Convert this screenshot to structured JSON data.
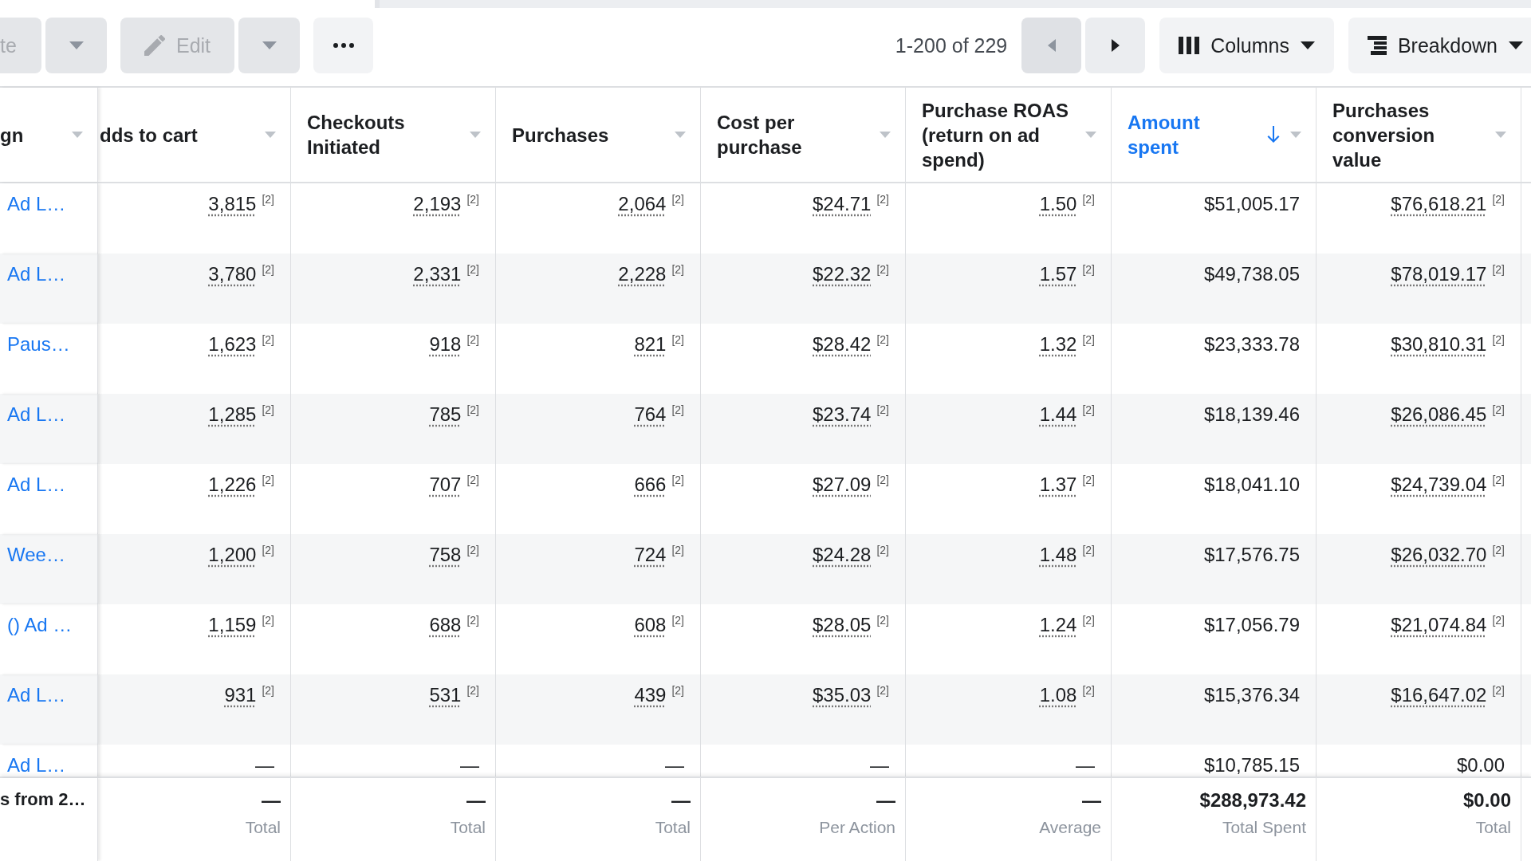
{
  "toolbar": {
    "actions": [
      {
        "kind": "split",
        "label": "te",
        "disabled": true
      },
      {
        "kind": "edit",
        "label": "Edit",
        "disabled": true
      },
      {
        "kind": "more"
      }
    ],
    "pagination": {
      "range": "1-200 of 229",
      "buttons": [
        {
          "kind": "prev",
          "disabled": true
        },
        {
          "kind": "next",
          "disabled": false
        }
      ]
    },
    "view_buttons": [
      {
        "kind": "columns",
        "label": "Columns"
      },
      {
        "kind": "breakdown",
        "label": "Breakdown"
      }
    ]
  },
  "table": {
    "columns": [
      {
        "label": "gn",
        "sorted": false
      },
      {
        "label": "dds to cart",
        "sorted": false
      },
      {
        "label": "Checkouts Initiated",
        "sorted": false
      },
      {
        "label": "Purchases",
        "sorted": false
      },
      {
        "label": "Cost per purchase",
        "sorted": false
      },
      {
        "label": "Purchase ROAS (return on ad spend)",
        "sorted": false
      },
      {
        "label": "Amount spent",
        "sorted": true
      },
      {
        "label": "Purchases conversion value",
        "sorted": false
      }
    ],
    "rows": [
      {
        "name": "Ad L…",
        "cells": [
          {
            "value": "3,815",
            "note": "[2]"
          },
          {
            "value": "2,193",
            "note": "[2]"
          },
          {
            "value": "2,064",
            "note": "[2]"
          },
          {
            "value": "$24.71",
            "note": "[2]"
          },
          {
            "value": "1.50",
            "note": "[2]"
          },
          {
            "value": "$51,005.17"
          },
          {
            "value": "$76,618.21",
            "note": "[2]"
          }
        ]
      },
      {
        "name": "Ad L…",
        "cells": [
          {
            "value": "3,780",
            "note": "[2]"
          },
          {
            "value": "2,331",
            "note": "[2]"
          },
          {
            "value": "2,228",
            "note": "[2]"
          },
          {
            "value": "$22.32",
            "note": "[2]"
          },
          {
            "value": "1.57",
            "note": "[2]"
          },
          {
            "value": "$49,738.05"
          },
          {
            "value": "$78,019.17",
            "note": "[2]"
          }
        ]
      },
      {
        "name": "Paus…",
        "cells": [
          {
            "value": "1,623",
            "note": "[2]"
          },
          {
            "value": "918",
            "note": "[2]"
          },
          {
            "value": "821",
            "note": "[2]"
          },
          {
            "value": "$28.42",
            "note": "[2]"
          },
          {
            "value": "1.32",
            "note": "[2]"
          },
          {
            "value": "$23,333.78"
          },
          {
            "value": "$30,810.31",
            "note": "[2]"
          }
        ]
      },
      {
        "name": "Ad L…",
        "cells": [
          {
            "value": "1,285",
            "note": "[2]"
          },
          {
            "value": "785",
            "note": "[2]"
          },
          {
            "value": "764",
            "note": "[2]"
          },
          {
            "value": "$23.74",
            "note": "[2]"
          },
          {
            "value": "1.44",
            "note": "[2]"
          },
          {
            "value": "$18,139.46"
          },
          {
            "value": "$26,086.45",
            "note": "[2]"
          }
        ]
      },
      {
        "name": "Ad L…",
        "cells": [
          {
            "value": "1,226",
            "note": "[2]"
          },
          {
            "value": "707",
            "note": "[2]"
          },
          {
            "value": "666",
            "note": "[2]"
          },
          {
            "value": "$27.09",
            "note": "[2]"
          },
          {
            "value": "1.37",
            "note": "[2]"
          },
          {
            "value": "$18,041.10"
          },
          {
            "value": "$24,739.04",
            "note": "[2]"
          }
        ]
      },
      {
        "name": "Wee…",
        "cells": [
          {
            "value": "1,200",
            "note": "[2]"
          },
          {
            "value": "758",
            "note": "[2]"
          },
          {
            "value": "724",
            "note": "[2]"
          },
          {
            "value": "$24.28",
            "note": "[2]"
          },
          {
            "value": "1.48",
            "note": "[2]"
          },
          {
            "value": "$17,576.75"
          },
          {
            "value": "$26,032.70",
            "note": "[2]"
          }
        ]
      },
      {
        "name": "() Ad …",
        "cells": [
          {
            "value": "1,159",
            "note": "[2]"
          },
          {
            "value": "688",
            "note": "[2]"
          },
          {
            "value": "608",
            "note": "[2]"
          },
          {
            "value": "$28.05",
            "note": "[2]"
          },
          {
            "value": "1.24",
            "note": "[2]"
          },
          {
            "value": "$17,056.79"
          },
          {
            "value": "$21,074.84",
            "note": "[2]"
          }
        ]
      },
      {
        "name": "Ad L…",
        "cells": [
          {
            "value": "931",
            "note": "[2]"
          },
          {
            "value": "531",
            "note": "[2]"
          },
          {
            "value": "439",
            "note": "[2]"
          },
          {
            "value": "$35.03",
            "note": "[2]"
          },
          {
            "value": "1.08",
            "note": "[2]"
          },
          {
            "value": "$15,376.34"
          },
          {
            "value": "$16,647.02",
            "note": "[2]"
          }
        ]
      },
      {
        "name": "Ad L…",
        "cells": [
          {
            "value": "—"
          },
          {
            "value": "—"
          },
          {
            "value": "—"
          },
          {
            "value": "—"
          },
          {
            "value": "—"
          },
          {
            "value": "$10,785.15"
          },
          {
            "value": "$0.00"
          }
        ]
      }
    ],
    "totals": {
      "label": "s from 2…",
      "cells": [
        {
          "value": "—",
          "caption": "Total"
        },
        {
          "value": "—",
          "caption": "Total"
        },
        {
          "value": "—",
          "caption": "Total"
        },
        {
          "value": "—",
          "caption": "Per Action"
        },
        {
          "value": "—",
          "caption": "Average"
        },
        {
          "value": "$288,973.42",
          "caption": "Total Spent"
        },
        {
          "value": "$0.00",
          "caption": "Total"
        }
      ]
    }
  }
}
